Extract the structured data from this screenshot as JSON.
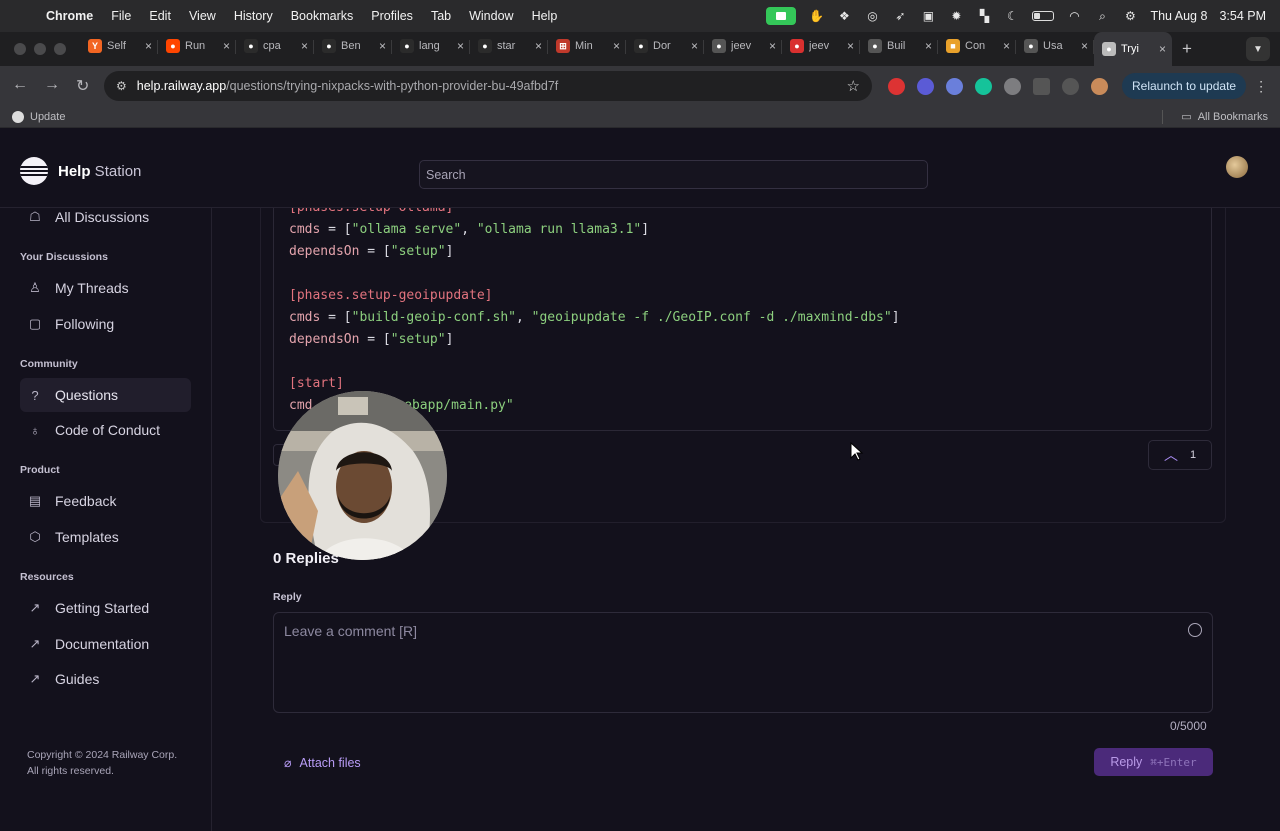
{
  "menubar": {
    "app": "Chrome",
    "menus": [
      "File",
      "Edit",
      "View",
      "History",
      "Bookmarks",
      "Profiles",
      "Tab",
      "Window",
      "Help"
    ],
    "date": "Thu Aug 8",
    "time": "3:54 PM"
  },
  "tabs": [
    {
      "label": "Self",
      "color": "#f26522",
      "glyph": "Y"
    },
    {
      "label": "Run",
      "color": "#ff4500",
      "glyph": "●"
    },
    {
      "label": "cpa",
      "color": "#2b2b2b",
      "glyph": "●"
    },
    {
      "label": "Ben",
      "color": "#2b2b2b",
      "glyph": "●"
    },
    {
      "label": "lang",
      "color": "#2b2b2b",
      "glyph": "●"
    },
    {
      "label": "star",
      "color": "#2b2b2b",
      "glyph": "●"
    },
    {
      "label": "Min",
      "color": "#c0392b",
      "glyph": "⊞"
    },
    {
      "label": "Dor",
      "color": "#2b2b2b",
      "glyph": "●"
    },
    {
      "label": "jeev",
      "color": "#555",
      "glyph": "●"
    },
    {
      "label": "jeev",
      "color": "#d9302f",
      "glyph": "●"
    },
    {
      "label": "Buil",
      "color": "#555",
      "glyph": "●"
    },
    {
      "label": "Con",
      "color": "#e9a12b",
      "glyph": "■"
    },
    {
      "label": "Usa",
      "color": "#555",
      "glyph": "●"
    },
    {
      "label": "Tryi",
      "color": "#bbb",
      "glyph": "●",
      "active": true
    }
  ],
  "address": {
    "host": "help.railway.app",
    "path": "/questions/trying-nixpacks-with-python-provider-bu-49afbd7f"
  },
  "relaunch_label": "Relaunch to update",
  "bookmarks": {
    "update_label": "Update",
    "all_label": "All Bookmarks"
  },
  "site": {
    "brand_bold": "Help",
    "brand_light": " Station",
    "search_placeholder": "Search"
  },
  "sidebar": {
    "all_discussions": "All Discussions",
    "your_discussions": "Your Discussions",
    "my_threads": "My Threads",
    "following": "Following",
    "community": "Community",
    "questions": "Questions",
    "code_of_conduct": "Code of Conduct",
    "product": "Product",
    "feedback": "Feedback",
    "templates": "Templates",
    "resources": "Resources",
    "getting_started": "Getting Started",
    "documentation": "Documentation",
    "guides": "Guides",
    "copyright_1": "Copyright © 2024 Railway Corp.",
    "copyright_2": "All rights reserved."
  },
  "code": {
    "l1_section": "[phases.setup-ollama]",
    "l2_key": "cmds",
    "l2_eq": " = [",
    "l2_v1": "\"ollama serve\"",
    "l2_comma": ", ",
    "l2_v2": "\"ollama run llama3.1\"",
    "l2_end": "]",
    "l3_key": "dependsOn",
    "l3_eq": " = [",
    "l3_v": "\"setup\"",
    "l3_end": "]",
    "l5_section": "[phases.setup-geoipupdate]",
    "l6_key": "cmds",
    "l6_eq": " = [",
    "l6_v1": "\"build-geoip-conf.sh\"",
    "l6_comma": ", ",
    "l6_v2": "\"geoipupdate -f ./GeoIP.conf -d ./maxmind-dbs\"",
    "l6_end": "]",
    "l7_key": "dependsOn",
    "l7_eq": " = [",
    "l7_v": "\"setup\"",
    "l7_end": "]",
    "l9_section": "[start]",
    "l10_key": "cmd",
    "l10_v": "/webapp/main.py\""
  },
  "post": {
    "vote_count": "1",
    "replies_title": "0 Replies",
    "reply_label": "Reply",
    "reply_placeholder": "Leave a comment [R]",
    "char_counter": "0/5000",
    "attach_label": "Attach files",
    "reply_button": "Reply",
    "reply_shortcut": "⌘+Enter"
  }
}
